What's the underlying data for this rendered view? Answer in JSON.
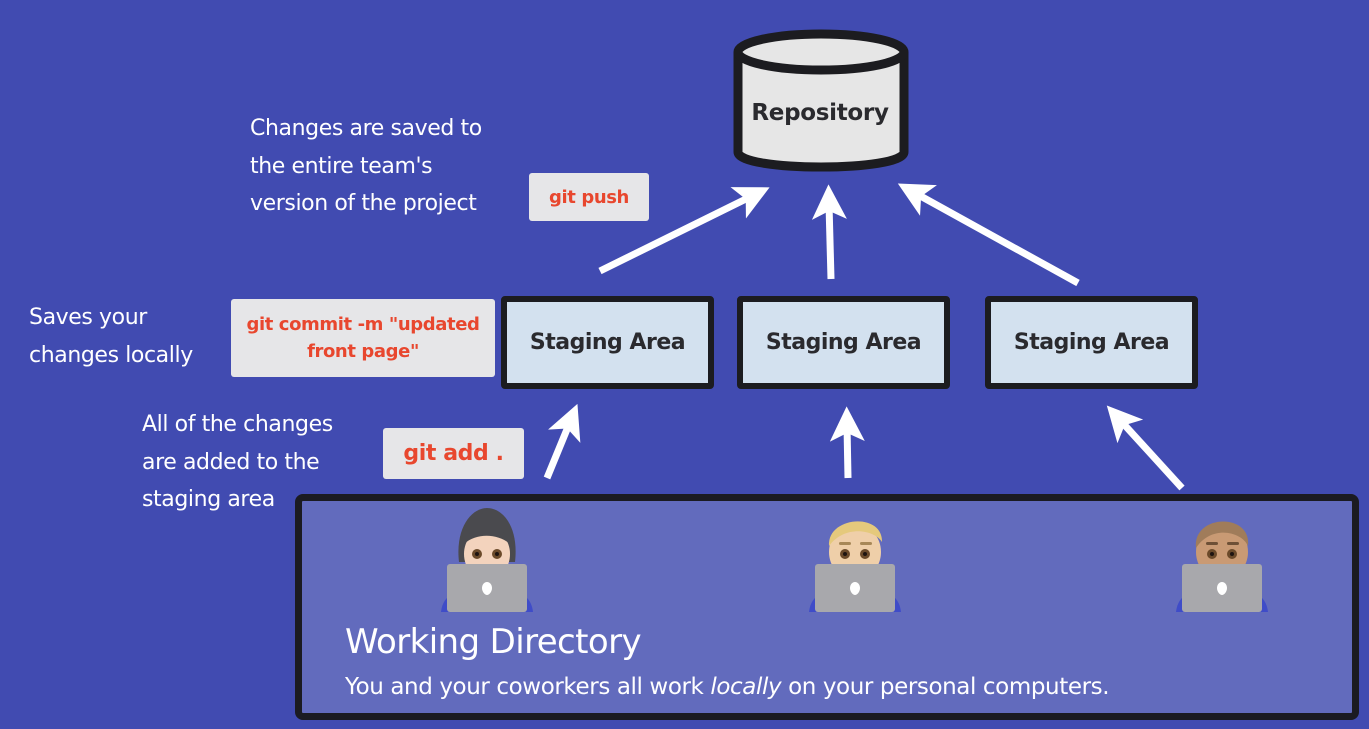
{
  "repository": {
    "label": "Repository",
    "fill": "#e6e6e6",
    "stroke": "#1c1c20"
  },
  "notes": {
    "push": [
      "Changes are saved to",
      "the entire team's",
      "version of the project"
    ],
    "commit": [
      "Saves your",
      "changes locally"
    ],
    "add": [
      "All of the changes",
      "are added to the",
      "staging area"
    ]
  },
  "commands": {
    "push": "git push",
    "commit_line1": "git commit -m \"updated",
    "commit_line2": "front page\"",
    "add": "git add ."
  },
  "staging_areas": [
    {
      "label": "Staging Area"
    },
    {
      "label": "Staging Area"
    },
    {
      "label": "Staging Area"
    }
  ],
  "working_directory": {
    "title": "Working Directory",
    "subtitle_before": "You and your coworkers all work ",
    "subtitle_emphasis": "locally",
    "subtitle_after": " on your personal computers.",
    "people": [
      {
        "name": "woman-technologist",
        "skin": "#f3d3bd",
        "hair": "#4a4a4e"
      },
      {
        "name": "man-technologist",
        "skin": "#efcfa9",
        "hair": "#e5c97c"
      },
      {
        "name": "technologist",
        "skin": "#c99a74",
        "hair": "#a07c5a"
      }
    ]
  },
  "colors": {
    "background": "#414bb1",
    "working_dir_fill": "#626bbd",
    "staging_fill": "#d3e1ef",
    "chip_fill": "#e6e6e8",
    "command_text": "#e8472e",
    "box_text": "#2a2a2e",
    "border": "#1c1c20",
    "arrow": "#ffffff"
  }
}
